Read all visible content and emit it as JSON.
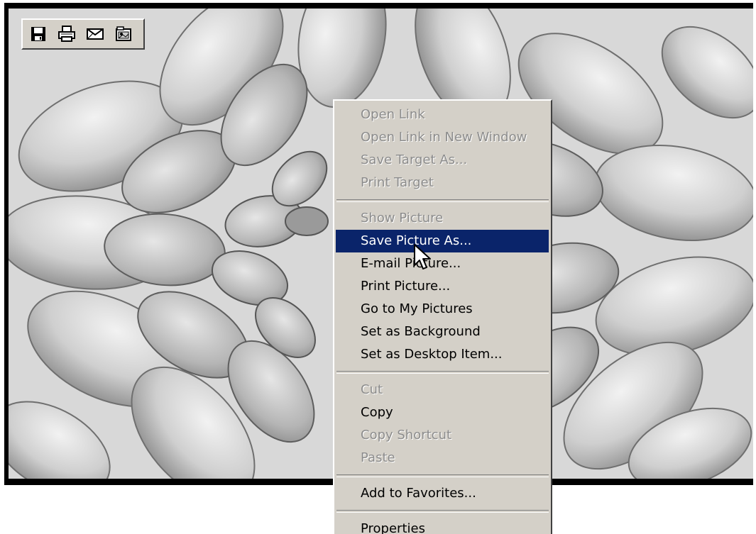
{
  "toolbar": {
    "buttons": [
      {
        "icon": "save-icon"
      },
      {
        "icon": "print-icon"
      },
      {
        "icon": "mail-icon"
      },
      {
        "icon": "my-pictures-icon"
      }
    ]
  },
  "context_menu": {
    "items": [
      {
        "label": "Open Link",
        "enabled": false
      },
      {
        "label": "Open Link in New Window",
        "enabled": false
      },
      {
        "label": "Save Target As...",
        "enabled": false
      },
      {
        "label": "Print Target",
        "enabled": false
      },
      {
        "label": "Show Picture",
        "enabled": false
      },
      {
        "label": "Save Picture As...",
        "enabled": true,
        "highlighted": true
      },
      {
        "label": "E-mail Picture...",
        "enabled": true
      },
      {
        "label": "Print Picture...",
        "enabled": true
      },
      {
        "label": "Go to My Pictures",
        "enabled": true
      },
      {
        "label": "Set as Background",
        "enabled": true
      },
      {
        "label": "Set as Desktop Item...",
        "enabled": true
      },
      {
        "label": "Cut",
        "enabled": false
      },
      {
        "label": "Copy",
        "enabled": true
      },
      {
        "label": "Copy Shortcut",
        "enabled": false
      },
      {
        "label": "Paste",
        "enabled": false
      },
      {
        "label": "Add to Favorites...",
        "enabled": true
      },
      {
        "label": "Properties",
        "enabled": true
      }
    ]
  },
  "colors": {
    "menu_background": "#d4d0c8",
    "highlight": "#0a246a",
    "frame": "#000000"
  }
}
